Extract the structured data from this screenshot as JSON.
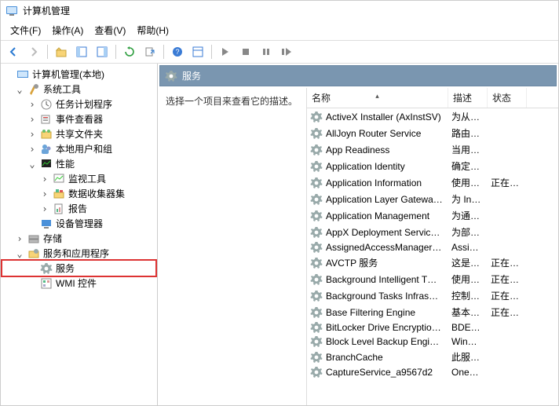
{
  "window_title": "计算机管理",
  "menu": {
    "file": "文件(F)",
    "action": "操作(A)",
    "view": "查看(V)",
    "help": "帮助(H)"
  },
  "tree": {
    "root": "计算机管理(本地)",
    "system_tools": "系统工具",
    "task_scheduler": "任务计划程序",
    "event_viewer": "事件查看器",
    "shared_folders": "共享文件夹",
    "local_users": "本地用户和组",
    "performance": "性能",
    "monitor_tools": "监视工具",
    "data_collector": "数据收集器集",
    "reports": "报告",
    "device_manager": "设备管理器",
    "storage": "存储",
    "services_apps": "服务和应用程序",
    "services": "服务",
    "wmi": "WMI 控件"
  },
  "panel": {
    "title": "服务",
    "hint": "选择一个项目来查看它的描述。"
  },
  "columns": {
    "name": "名称",
    "desc": "描述",
    "status": "状态"
  },
  "services": [
    {
      "name": "ActiveX Installer (AxInstSV)",
      "desc": "为从…",
      "status": ""
    },
    {
      "name": "AllJoyn Router Service",
      "desc": "路由…",
      "status": ""
    },
    {
      "name": "App Readiness",
      "desc": "当用…",
      "status": ""
    },
    {
      "name": "Application Identity",
      "desc": "确定…",
      "status": ""
    },
    {
      "name": "Application Information",
      "desc": "使用…",
      "status": "正在…"
    },
    {
      "name": "Application Layer Gatewa…",
      "desc": "为 In…",
      "status": ""
    },
    {
      "name": "Application Management",
      "desc": "为通…",
      "status": ""
    },
    {
      "name": "AppX Deployment Servic…",
      "desc": "为部…",
      "status": ""
    },
    {
      "name": "AssignedAccessManager…",
      "desc": "Assi…",
      "status": ""
    },
    {
      "name": "AVCTP 服务",
      "desc": "这是…",
      "status": "正在…"
    },
    {
      "name": "Background Intelligent T…",
      "desc": "使用…",
      "status": "正在…"
    },
    {
      "name": "Background Tasks Infras…",
      "desc": "控制…",
      "status": "正在…"
    },
    {
      "name": "Base Filtering Engine",
      "desc": "基本…",
      "status": "正在…"
    },
    {
      "name": "BitLocker Drive Encryptio…",
      "desc": "BDE…",
      "status": ""
    },
    {
      "name": "Block Level Backup Engi…",
      "desc": "Win…",
      "status": ""
    },
    {
      "name": "BranchCache",
      "desc": "此服…",
      "status": ""
    },
    {
      "name": "CaptureService_a9567d2",
      "desc": "One…",
      "status": ""
    }
  ]
}
